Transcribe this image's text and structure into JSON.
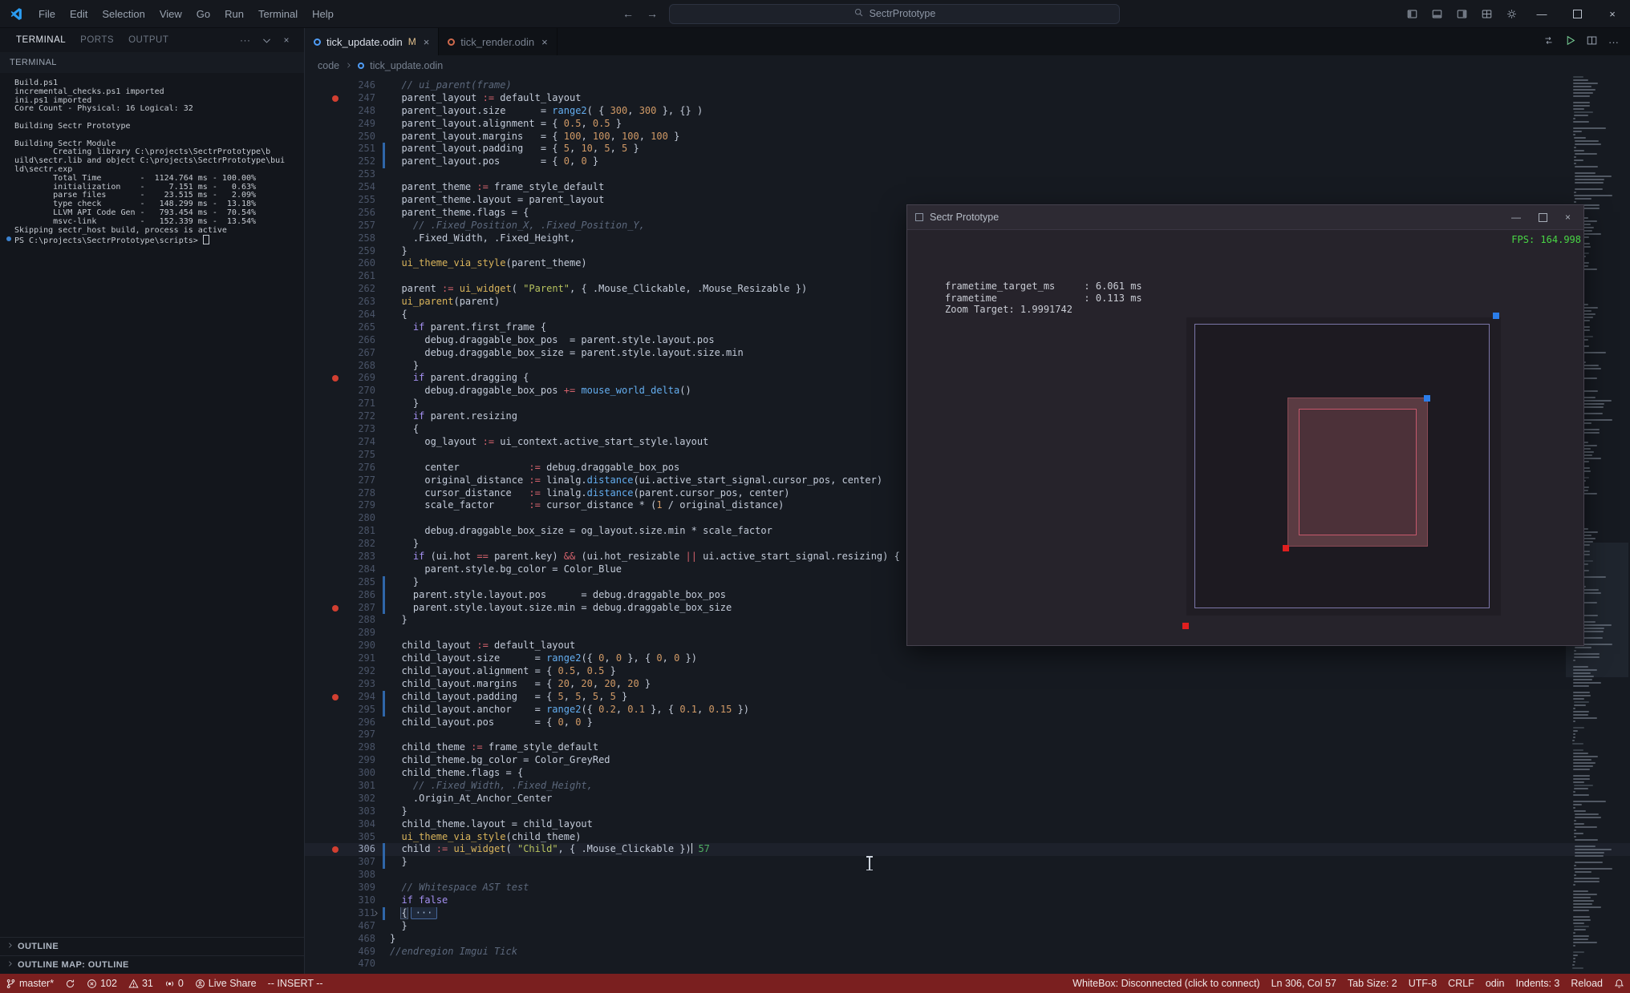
{
  "theme": {
    "status-bg": "#7a1f1f",
    "fps-green": "#49d645",
    "breakpoint-red": "#d23f31",
    "gitbar-blue": "#2f66a8",
    "dot-blue": "#2b7de9",
    "dot-red": "#e01f1f",
    "maroon-fill": "#5a3b42",
    "maroon-border": "#c6596d",
    "outer-border": "#7b76a8"
  },
  "title_bar": {
    "menus": [
      "File",
      "Edit",
      "Selection",
      "View",
      "Go",
      "Run",
      "Terminal",
      "Help"
    ],
    "search_text": "SectrPrototype",
    "action_icons": [
      "layout-sidebar-left",
      "layout-panel",
      "layout-sidebar-right",
      "layout-customize",
      "gear"
    ]
  },
  "panel": {
    "tabs": [
      {
        "label": "TERMINAL",
        "active": true
      },
      {
        "label": "PORTS",
        "active": false
      },
      {
        "label": "OUTPUT",
        "active": false
      }
    ],
    "section_label": "TERMINAL",
    "terminal_lines": [
      "Build.ps1",
      "incremental_checks.ps1 imported",
      "ini.ps1 imported",
      "Core Count - Physical: 16 Logical: 32",
      "",
      "Building Sectr Prototype",
      "",
      "Building Sectr Module",
      "        Creating library C:\\projects\\SectrPrototype\\b",
      "uild\\sectr.lib and object C:\\projects\\SectrPrototype\\bui",
      "ld\\sectr.exp",
      "        Total Time        -  1124.764 ms - 100.00%",
      "        initialization    -     7.151 ms -   0.63%",
      "        parse files       -    23.515 ms -   2.09%",
      "        type check        -   148.299 ms -  13.18%",
      "        LLVM API Code Gen -   793.454 ms -  70.54%",
      "        msvc-link         -   152.339 ms -  13.54%",
      "Skipping sectr_host build, process is active"
    ],
    "prompt": "PS C:\\projects\\SectrPrototype\\scripts> ",
    "outline": {
      "label": "OUTLINE"
    },
    "outline_map": {
      "label": "OUTLINE MAP: OUTLINE"
    }
  },
  "editor": {
    "tabs": [
      {
        "name": "tick_update.odin",
        "git": "M",
        "active": true,
        "icon_color": "#4f9cf5"
      },
      {
        "name": "tick_render.odin",
        "git": "",
        "active": false,
        "icon_color": "#cf6a4c"
      }
    ],
    "breadcrumb": {
      "folder": "code",
      "file": "tick_update.odin"
    },
    "current_line": 306,
    "breakpoint_lines": [
      247,
      269,
      287,
      294,
      306
    ],
    "changed_lines": [
      251,
      252,
      285,
      286,
      287,
      294,
      295,
      306,
      307,
      311
    ],
    "code_lines": [
      {
        "n": 246,
        "t": "  // ui_parent(frame)"
      },
      {
        "n": 247,
        "t": "  parent_layout := default_layout"
      },
      {
        "n": 248,
        "t": "  parent_layout.size      = range2( { 300, 300 }, {} )"
      },
      {
        "n": 249,
        "t": "  parent_layout.alignment = { 0.5, 0.5 }"
      },
      {
        "n": 250,
        "t": "  parent_layout.margins   = { 100, 100, 100, 100 }"
      },
      {
        "n": 251,
        "t": "  parent_layout.padding   = { 5, 10, 5, 5 }"
      },
      {
        "n": 252,
        "t": "  parent_layout.pos       = { 0, 0 }"
      },
      {
        "n": 253,
        "t": ""
      },
      {
        "n": 254,
        "t": "  parent_theme := frame_style_default"
      },
      {
        "n": 255,
        "t": "  parent_theme.layout = parent_layout"
      },
      {
        "n": 256,
        "t": "  parent_theme.flags = {"
      },
      {
        "n": 257,
        "t": "    // .Fixed_Position_X, .Fixed_Position_Y,"
      },
      {
        "n": 258,
        "t": "    .Fixed_Width, .Fixed_Height,"
      },
      {
        "n": 259,
        "t": "  }"
      },
      {
        "n": 260,
        "t": "  ui_theme_via_style(parent_theme)"
      },
      {
        "n": 261,
        "t": ""
      },
      {
        "n": 262,
        "t": "  parent := ui_widget( \"Parent\", { .Mouse_Clickable, .Mouse_Resizable })"
      },
      {
        "n": 263,
        "t": "  ui_parent(parent)"
      },
      {
        "n": 264,
        "t": "  {"
      },
      {
        "n": 265,
        "t": "    if parent.first_frame {"
      },
      {
        "n": 266,
        "t": "      debug.draggable_box_pos  = parent.style.layout.pos"
      },
      {
        "n": 267,
        "t": "      debug.draggable_box_size = parent.style.layout.size.min"
      },
      {
        "n": 268,
        "t": "    }"
      },
      {
        "n": 269,
        "t": "    if parent.dragging {"
      },
      {
        "n": 270,
        "t": "      debug.draggable_box_pos += mouse_world_delta()"
      },
      {
        "n": 271,
        "t": "    }"
      },
      {
        "n": 272,
        "t": "    if parent.resizing"
      },
      {
        "n": 273,
        "t": "    {"
      },
      {
        "n": 274,
        "t": "      og_layout := ui_context.active_start_style.layout"
      },
      {
        "n": 275,
        "t": ""
      },
      {
        "n": 276,
        "t": "      center            := debug.draggable_box_pos"
      },
      {
        "n": 277,
        "t": "      original_distance := linalg.distance(ui.active_start_signal.cursor_pos, center)"
      },
      {
        "n": 278,
        "t": "      cursor_distance   := linalg.distance(parent.cursor_pos, center)"
      },
      {
        "n": 279,
        "t": "      scale_factor      := cursor_distance * (1 / original_distance)"
      },
      {
        "n": 280,
        "t": ""
      },
      {
        "n": 281,
        "t": "      debug.draggable_box_size = og_layout.size.min * scale_factor"
      },
      {
        "n": 282,
        "t": "    }"
      },
      {
        "n": 283,
        "t": "    if (ui.hot == parent.key) && (ui.hot_resizable || ui.active_start_signal.resizing) {"
      },
      {
        "n": 284,
        "t": "      parent.style.bg_color = Color_Blue"
      },
      {
        "n": 285,
        "t": "    }"
      },
      {
        "n": 286,
        "t": "    parent.style.layout.pos      = debug.draggable_box_pos"
      },
      {
        "n": 287,
        "t": "    parent.style.layout.size.min = debug.draggable_box_size"
      },
      {
        "n": 288,
        "t": "  }"
      },
      {
        "n": 289,
        "t": ""
      },
      {
        "n": 290,
        "t": "  child_layout := default_layout"
      },
      {
        "n": 291,
        "t": "  child_layout.size      = range2({ 0, 0 }, { 0, 0 })"
      },
      {
        "n": 292,
        "t": "  child_layout.alignment = { 0.5, 0.5 }"
      },
      {
        "n": 293,
        "t": "  child_layout.margins   = { 20, 20, 20, 20 }"
      },
      {
        "n": 294,
        "t": "  child_layout.padding   = { 5, 5, 5, 5 }"
      },
      {
        "n": 295,
        "t": "  child_layout.anchor    = range2({ 0.2, 0.1 }, { 0.1, 0.15 })"
      },
      {
        "n": 296,
        "t": "  child_layout.pos       = { 0, 0 }"
      },
      {
        "n": 297,
        "t": ""
      },
      {
        "n": 298,
        "t": "  child_theme := frame_style_default"
      },
      {
        "n": 299,
        "t": "  child_theme.bg_color = Color_GreyRed"
      },
      {
        "n": 300,
        "t": "  child_theme.flags = {"
      },
      {
        "n": 301,
        "t": "    // .Fixed_Width, .Fixed_Height,"
      },
      {
        "n": 302,
        "t": "    .Origin_At_Anchor_Center"
      },
      {
        "n": 303,
        "t": "  }"
      },
      {
        "n": 304,
        "t": "  child_theme.layout = child_layout"
      },
      {
        "n": 305,
        "t": "  ui_theme_via_style(child_theme)"
      },
      {
        "n": 306,
        "t": "  child := ui_widget( \"Child\", { .Mouse_Clickable })",
        "hint": "57"
      },
      {
        "n": 307,
        "t": "  }"
      },
      {
        "n": 308,
        "t": ""
      },
      {
        "n": 309,
        "t": "  // Whitespace AST test"
      },
      {
        "n": 310,
        "t": "  if false"
      },
      {
        "n": 311,
        "t": "  {",
        "fold": true
      },
      {
        "n": 467,
        "t": "  }"
      },
      {
        "n": 468,
        "t": "}"
      },
      {
        "n": 469,
        "t": "//endregion Imgui Tick"
      },
      {
        "n": 470,
        "t": ""
      }
    ]
  },
  "overlay": {
    "title": "Sectr Prototype",
    "fps": "FPS: 164.998",
    "stats": [
      "frametime_target_ms     : 6.061 ms",
      "frametime               : 0.113 ms",
      "Zoom Target: 1.9991742"
    ]
  },
  "status_bar": {
    "left": [
      {
        "icon": "git-branch",
        "label": "master*",
        "name": "branch-indicator"
      },
      {
        "icon": "sync",
        "label": "",
        "name": "sync-changes-button"
      },
      {
        "icon": "error",
        "label": "102",
        "name": "errors-indicator"
      },
      {
        "icon": "warning",
        "label": "31",
        "name": "warnings-indicator"
      },
      {
        "icon": "broadcast",
        "label": "0",
        "name": "forwarded-ports-indicator"
      },
      {
        "icon": "live-share",
        "label": "Live Share",
        "name": "live-share-button"
      },
      {
        "icon": "",
        "label": "-- INSERT --",
        "name": "vim-mode-indicator"
      }
    ],
    "right": [
      {
        "icon": "",
        "label": "WhiteBox: Disconnected (click to connect)",
        "name": "whitebox-status"
      },
      {
        "icon": "",
        "label": "Ln 306, Col 57",
        "name": "cursor-position"
      },
      {
        "icon": "",
        "label": "Tab Size: 2",
        "name": "tab-size-indicator"
      },
      {
        "icon": "",
        "label": "UTF-8",
        "name": "encoding-indicator"
      },
      {
        "icon": "",
        "label": "CRLF",
        "name": "eol-indicator"
      },
      {
        "icon": "",
        "label": "odin",
        "name": "language-mode"
      },
      {
        "icon": "",
        "label": "Indents: 3",
        "name": "indents-indicator"
      },
      {
        "icon": "",
        "label": "Reload",
        "name": "reload-button"
      },
      {
        "icon": "bell",
        "label": "",
        "name": "notifications-bell"
      }
    ]
  }
}
